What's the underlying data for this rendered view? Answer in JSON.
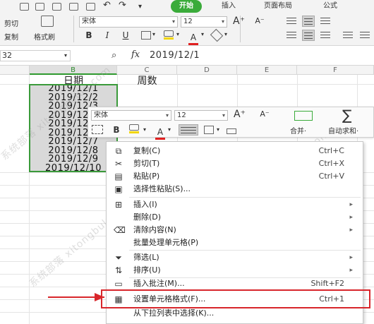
{
  "ribbon": {
    "tabs": {
      "start": "开始",
      "insert": "插入",
      "page_layout": "页面布局",
      "formula": "公式"
    },
    "clipboard": {
      "cut": "剪切",
      "copy": "复制",
      "format_painter": "格式刷"
    },
    "font": {
      "name": "宋体",
      "size": "12"
    },
    "format": {
      "bold": "B",
      "italic": "I",
      "underline": "U",
      "font_color_glyph": "A"
    },
    "grow_font": "A⁺",
    "shrink_font": "A⁻"
  },
  "formula_bar": {
    "name_box": "32",
    "fx_label": "fx",
    "value": "2019/12/1"
  },
  "columns": [
    "B",
    "C",
    "D",
    "E",
    "F"
  ],
  "headers": {
    "b": "日期",
    "c": "周数"
  },
  "dates": [
    "2019/12/1",
    "2019/12/2",
    "2019/12/3",
    "2019/12/4",
    "2019/12/5",
    "2019/12/6",
    "2019/12/7",
    "2019/12/8",
    "2019/12/9",
    "2019/12/10"
  ],
  "mini_toolbar": {
    "font": "宋体",
    "size": "12",
    "bold": "B",
    "merge_label": "合并·",
    "autosum_label": "自动求和·"
  },
  "context_menu": {
    "items": [
      {
        "label": "复制(C)",
        "shortcut": "Ctrl+C",
        "icon": "copy-icon"
      },
      {
        "label": "剪切(T)",
        "shortcut": "Ctrl+X",
        "icon": "scissors-icon"
      },
      {
        "label": "粘贴(P)",
        "shortcut": "Ctrl+V",
        "icon": "paste-icon"
      },
      {
        "label": "选择性粘贴(S)...",
        "shortcut": "",
        "icon": "paste-special-icon"
      },
      {
        "label": "插入(I)",
        "shortcut": "",
        "icon": "insert-icon"
      },
      {
        "label": "删除(D)",
        "shortcut": "",
        "icon": ""
      },
      {
        "label": "清除内容(N)",
        "shortcut": "",
        "icon": "eraser-icon"
      },
      {
        "label": "批量处理单元格(P)",
        "shortcut": "",
        "icon": ""
      },
      {
        "label": "筛选(L)",
        "shortcut": "",
        "icon": "filter-icon"
      },
      {
        "label": "排序(U)",
        "shortcut": "",
        "icon": "sort-icon"
      },
      {
        "label": "插入批注(M)...",
        "shortcut": "Shift+F2",
        "icon": "comment-icon"
      },
      {
        "label": "设置单元格格式(F)...",
        "shortcut": "Ctrl+1",
        "icon": "format-cells-icon"
      },
      {
        "label": "从下拉列表中选择(K)...",
        "shortcut": "",
        "icon": ""
      }
    ]
  },
  "watermark": "系统部落 xitongbuluo.com",
  "colors": {
    "accent_green": "#3aab3a",
    "highlight_red": "#d8262b",
    "selection_gray": "#d9d9d9"
  }
}
